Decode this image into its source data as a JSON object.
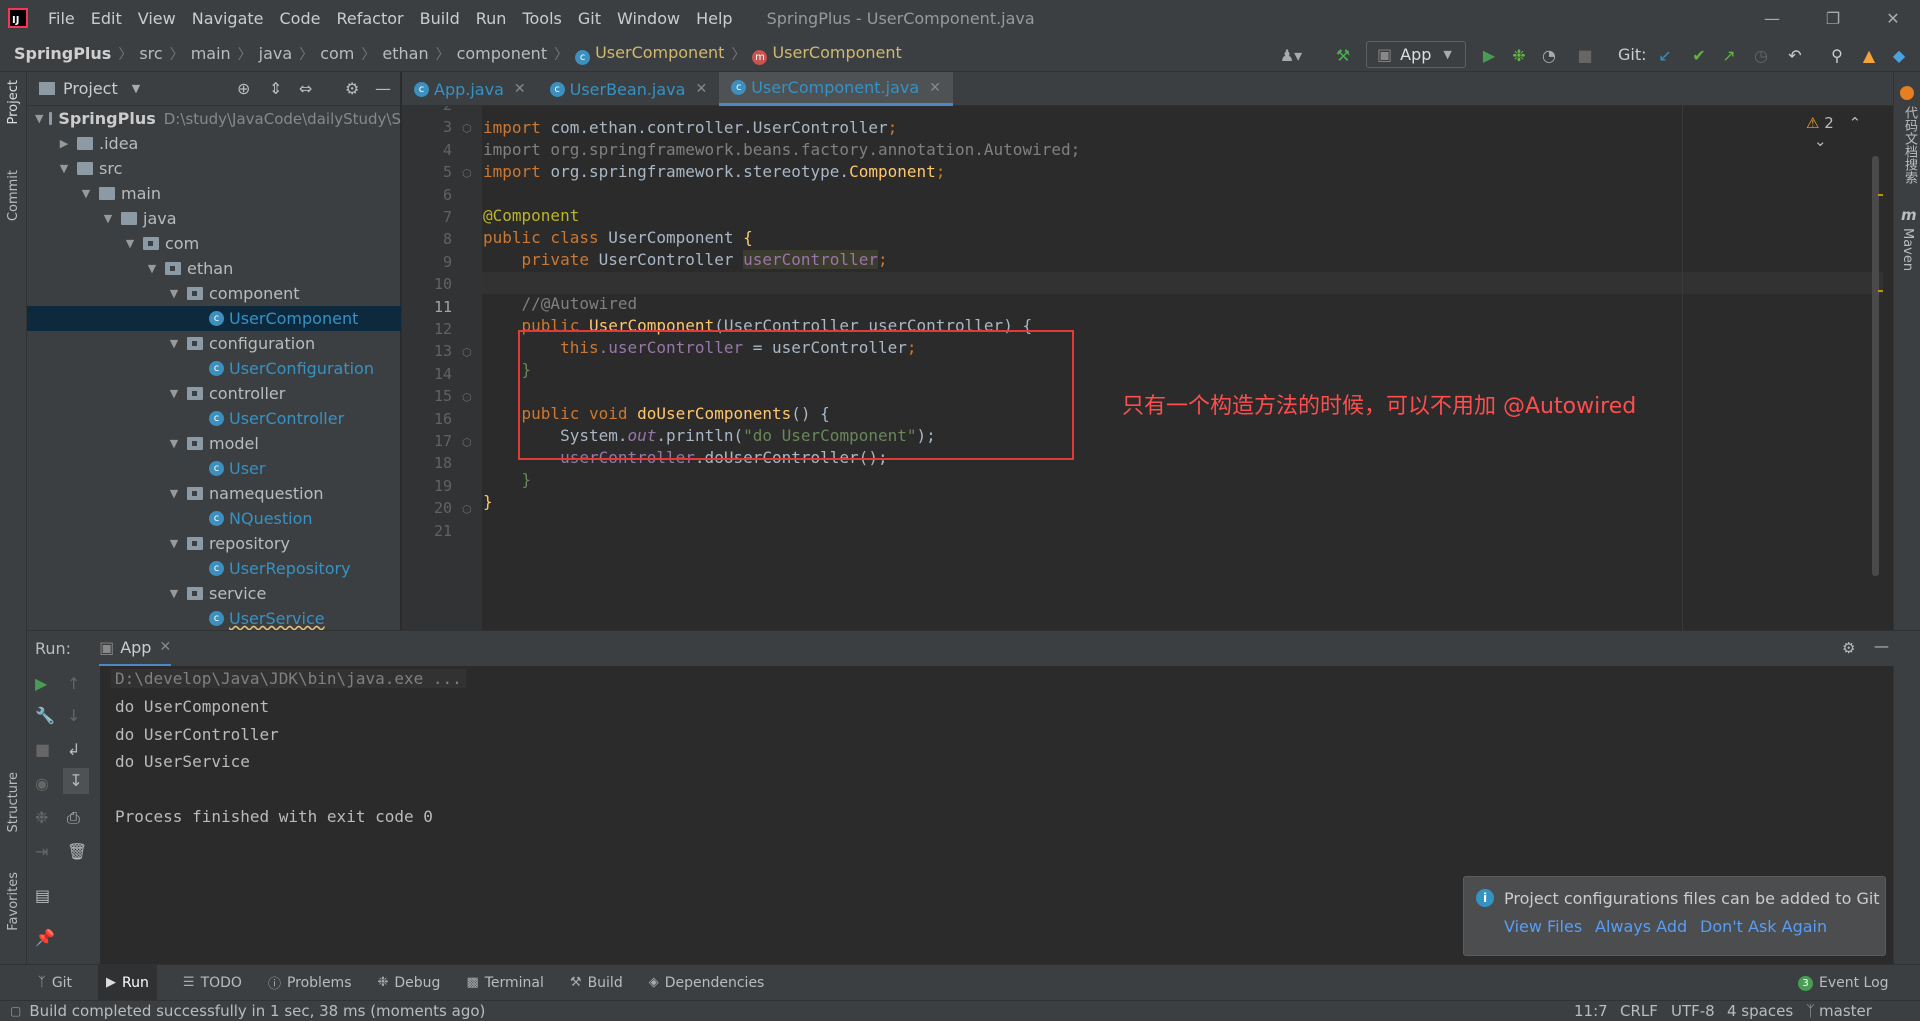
{
  "app": {
    "title": "SpringPlus - UserComponent.java",
    "menu": [
      "File",
      "Edit",
      "View",
      "Navigate",
      "Code",
      "Refactor",
      "Build",
      "Run",
      "Tools",
      "Git",
      "Window",
      "Help"
    ]
  },
  "breadcrumb": [
    "SpringPlus",
    "src",
    "main",
    "java",
    "com",
    "ethan",
    "component",
    "UserComponent",
    "UserComponent"
  ],
  "toolbar": {
    "run_config": "App",
    "git_label": "Git:"
  },
  "project_panel": {
    "title": "Project",
    "root_name": "SpringPlus",
    "root_path": "D:\\study\\JavaCode\\dailyStudy\\S",
    "tree": [
      {
        "label": ".idea",
        "depth": 1,
        "kind": "folder",
        "expanded": false
      },
      {
        "label": "src",
        "depth": 1,
        "kind": "folder",
        "expanded": true
      },
      {
        "label": "main",
        "depth": 2,
        "kind": "folder",
        "expanded": true
      },
      {
        "label": "java",
        "depth": 3,
        "kind": "folder",
        "expanded": true
      },
      {
        "label": "com",
        "depth": 4,
        "kind": "package",
        "expanded": true
      },
      {
        "label": "ethan",
        "depth": 5,
        "kind": "package",
        "expanded": true
      },
      {
        "label": "component",
        "depth": 6,
        "kind": "package",
        "expanded": true
      },
      {
        "label": "UserComponent",
        "depth": 7,
        "kind": "class",
        "selected": true
      },
      {
        "label": "configuration",
        "depth": 6,
        "kind": "package",
        "expanded": true
      },
      {
        "label": "UserConfiguration",
        "depth": 7,
        "kind": "class"
      },
      {
        "label": "controller",
        "depth": 6,
        "kind": "package",
        "expanded": true
      },
      {
        "label": "UserController",
        "depth": 7,
        "kind": "class"
      },
      {
        "label": "model",
        "depth": 6,
        "kind": "package",
        "expanded": true
      },
      {
        "label": "User",
        "depth": 7,
        "kind": "class"
      },
      {
        "label": "namequestion",
        "depth": 6,
        "kind": "package",
        "expanded": true
      },
      {
        "label": "NQuestion",
        "depth": 7,
        "kind": "class"
      },
      {
        "label": "repository",
        "depth": 6,
        "kind": "package",
        "expanded": true
      },
      {
        "label": "UserRepository",
        "depth": 7,
        "kind": "class"
      },
      {
        "label": "service",
        "depth": 6,
        "kind": "package",
        "expanded": true
      },
      {
        "label": "UserService",
        "depth": 7,
        "kind": "class"
      }
    ]
  },
  "tabs": [
    {
      "label": "App.java",
      "active": false
    },
    {
      "label": "UserBean.java",
      "active": false
    },
    {
      "label": "UserComponent.java",
      "active": true
    }
  ],
  "editor": {
    "warning_count": "2",
    "line_numbers": [
      "2",
      "3",
      "4",
      "5",
      "6",
      "7",
      "8",
      "9",
      "10",
      "11",
      "12",
      "13",
      "14",
      "15",
      "16",
      "17",
      "18",
      "19",
      "20",
      "21"
    ],
    "current_line": "11",
    "code": {
      "l3_kw": "import ",
      "l3_rest": "com.ethan.controller.UserController",
      "l4_text": "import org.springframework.beans.factory.annotation.Autowired;",
      "l5_kw": "import ",
      "l5_pkg": "org.springframework.stereotype.",
      "l5_cls": "Component",
      "l7_ann": "@Component",
      "l8_kw": "public class ",
      "l8_name": "UserComponent",
      "l8_brace": " {",
      "l9_kw": "private ",
      "l9_type": "UserController ",
      "l9_field": "userController",
      "l11_comment": "//@Autowired",
      "l12_kw": "public ",
      "l12_fn": "UserComponent",
      "l12_params": "(UserController userController) {",
      "l13_kw": "this",
      "l13_field": ".userController",
      "l13_rest": " = userController",
      "l14": "}",
      "l16_kw": "public void ",
      "l16_fn": "doUserComponents",
      "l16_rest": "() {",
      "l17_a": "System.",
      "l17_out": "out",
      "l17_b": ".println(",
      "l17_str": "\"do UserComponent\"",
      "l17_c": ");",
      "l18_field": "userController",
      "l18_rest": ".doUserController();",
      "l19": "}",
      "l20": "}"
    },
    "annotation": "只有一个构造方法的时候，可以不用加 @Autowired"
  },
  "run_panel": {
    "label": "Run:",
    "tab": "App",
    "console": [
      "D:\\develop\\Java\\JDK\\bin\\java.exe ...",
      "do UserComponent",
      "do UserController",
      "do UserService",
      "",
      "Process finished with exit code 0"
    ]
  },
  "notification": {
    "title": "Project configurations files can be added to Git",
    "actions": [
      "View Files",
      "Always Add",
      "Don't Ask Again"
    ]
  },
  "bottom_tools": [
    "Git",
    "Run",
    "TODO",
    "Problems",
    "Debug",
    "Terminal",
    "Build",
    "Dependencies"
  ],
  "event_log": {
    "label": "Event Log",
    "count": "3"
  },
  "left_strip": [
    "Project",
    "Commit",
    "Structure",
    "Favorites"
  ],
  "right_strip": [
    "代码文档搜索",
    "Maven"
  ],
  "status": {
    "message": "Build completed successfully in 1 sec, 38 ms (moments ago)",
    "position": "11:7",
    "line_sep": "CRLF",
    "encoding": "UTF-8",
    "indent": "4 spaces",
    "branch": "master"
  },
  "colors": {
    "accent_blue": "#3592c4",
    "annotation_red": "#e53935",
    "keyword": "#cc7832",
    "annotation": "#bbb529",
    "field": "#9876aa",
    "function": "#ffc66d",
    "string": "#6a8759"
  }
}
